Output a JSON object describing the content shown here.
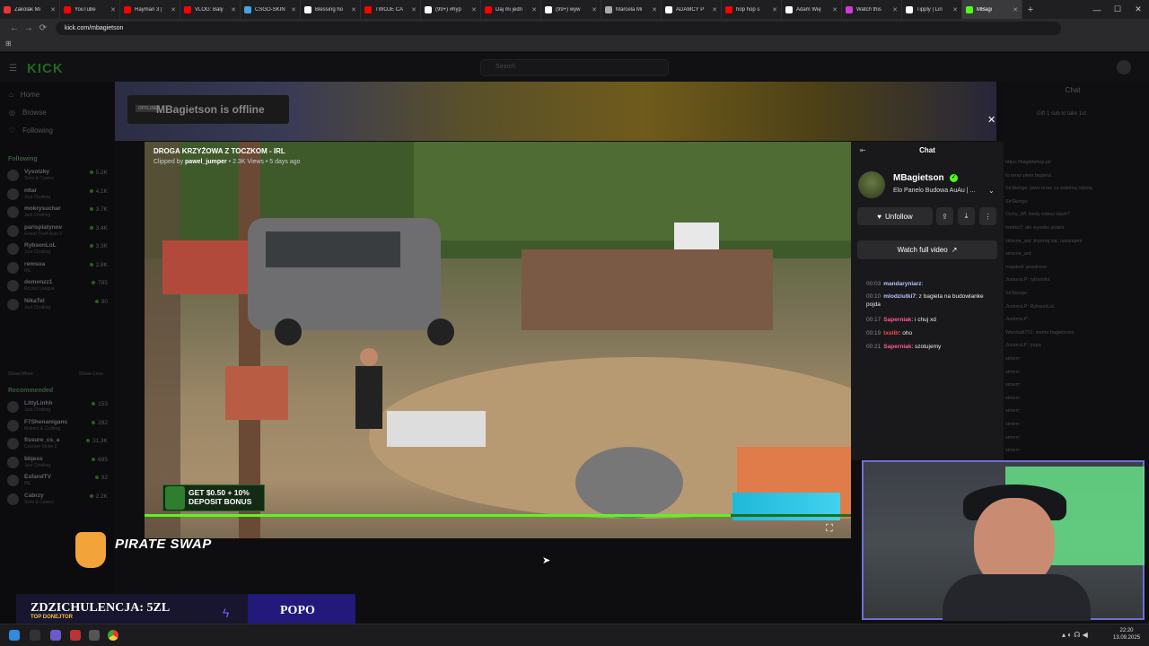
{
  "browser": {
    "tabs": [
      {
        "label": "Zakolak Mi",
        "color": "#e33"
      },
      {
        "label": "YouTube",
        "color": "#f00"
      },
      {
        "label": "Rayman 3 |",
        "color": "#f00"
      },
      {
        "label": "VLOG: Baly",
        "color": "#f00"
      },
      {
        "label": "CSGO-SKIN",
        "color": "#4aa3df"
      },
      {
        "label": "Blessing ho",
        "color": "#fff"
      },
      {
        "label": "TWOJE CA",
        "color": "#f00"
      },
      {
        "label": "(99+) #hyp",
        "color": "#fff"
      },
      {
        "label": "Daj mi jedn",
        "color": "#f00"
      },
      {
        "label": "(99+) wyw",
        "color": "#fff"
      },
      {
        "label": "Marcela Mi",
        "color": "#aaa"
      },
      {
        "label": "ADAMCY P",
        "color": "#fff"
      },
      {
        "label": "hop hop s",
        "color": "#f00"
      },
      {
        "label": "Adam Wię",
        "color": "#fff"
      },
      {
        "label": "Watch this",
        "color": "#d43ad8"
      },
      {
        "label": "Tipply | Lin",
        "color": "#fff"
      },
      {
        "label": "MBagi",
        "color": "#53fc18"
      }
    ],
    "url": "kick.com/mbagietson",
    "new_tab": "+",
    "controls": {
      "minimize": "—",
      "maximize": "☐",
      "close": "✕"
    }
  },
  "kick": {
    "logo": "KICK",
    "search_placeholder": "Search",
    "nav": [
      "Home",
      "Browse",
      "Following"
    ],
    "following_header": "Following",
    "recommended_header": "Recommended",
    "show_more": "Show More",
    "show_less": "Show Less",
    "following": [
      {
        "name": "Vysotzky",
        "cat": "Slots & Casino",
        "viewers": "5.2K"
      },
      {
        "name": "nitar",
        "cat": "Just Chatting",
        "viewers": "4.1K"
      },
      {
        "name": "mokrysuchar",
        "cat": "Just Chatting",
        "viewers": "3.7K"
      },
      {
        "name": "parisplatynov",
        "cat": "Grand Theft Auto V",
        "viewers": "3.4K"
      },
      {
        "name": "RybsonLoL",
        "cat": "Just Chatting",
        "viewers": "3.3K"
      },
      {
        "name": "remsua",
        "cat": "IRL",
        "viewers": "2.8K"
      },
      {
        "name": "demonzz1",
        "cat": "Rocket League",
        "viewers": "785"
      },
      {
        "name": "NikaTel",
        "cat": "Just Chatting",
        "viewers": "90"
      }
    ],
    "recommended": [
      {
        "name": "LittyLinhh",
        "cat": "Just Chatting",
        "viewers": "153"
      },
      {
        "name": "F7Shenanigans",
        "cat": "Makers & Crafting",
        "viewers": "292"
      },
      {
        "name": "fissure_cs_a",
        "cat": "Counter-Strike 2",
        "viewers": "31.3K"
      },
      {
        "name": "bbjess",
        "cat": "Just Chatting",
        "viewers": "695"
      },
      {
        "name": "EsfandTV",
        "cat": "IRL",
        "viewers": "92"
      },
      {
        "name": "Cabrzy",
        "cat": "Slots & Casino",
        "viewers": "2.2K"
      }
    ],
    "offline_tag": "OFFLINE",
    "offline_text": "MBagietson is offline",
    "right_chat": {
      "title": "Chat",
      "gift": "Gift 1 sub to take 1st",
      "lines": [
        "https://bagietshop.pl/",
        "to teraz piwo bagieta",
        "SirSkorge: piwo teraz za świetną robotę",
        "SirSkorge:",
        "Cichy_68: kiedy robisz dach?",
        "tomiks7: ale wysoko jesteś",
        "simone_ant: trzymaj się, nawzajem",
        "simone_ant:",
        "majakeli: pozdrooo",
        "JuniorsLP: rybsonlol",
        "SirSkorge:",
        "JuniorsLP: RybsonLoL",
        "JuniorsLP:",
        "Wiecha8701: siema bagietsonn",
        "JuniorsLP: papa",
        "simerr:",
        "simerr:",
        "simerr:",
        "simerr:",
        "simerr:",
        "simerr:",
        "simerr:",
        "simerr:",
        "simerr:"
      ]
    }
  },
  "clip": {
    "title": "DROGA KRZYŻOWA Z TOCZKOM - IRL",
    "clipped_by_label": "Clipped by",
    "clipper": "pawel_jumper",
    "views": "2.3K Views",
    "age": "5 days ago",
    "progress": 0.83,
    "bonus_ad": "GET $0.50 + 10% DEPOSIT BONUS",
    "close": "✕",
    "fullscreen": "⛶"
  },
  "chat_panel": {
    "collapse_icon": "⇤",
    "title": "Chat",
    "channel_name": "MBagietson",
    "verified": "✓",
    "description": "Elo Panelo Budowa AuAu | ...",
    "unfollow": "Unfollow",
    "watch_full": "Watch full video",
    "messages": [
      {
        "ts": "00:03",
        "user": "mandaryniarz",
        "color": "#b9c4ff",
        "text": ""
      },
      {
        "ts": "00:10",
        "user": "mlodziutki7",
        "color": "#b9c4ff",
        "text": "z bagieta na budowlanke pojda"
      },
      {
        "ts": "00:17",
        "user": "Saperniak",
        "color": "#ff5d8f",
        "text": "i chuj xd"
      },
      {
        "ts": "00:19",
        "user": "Ixstilr",
        "color": "#ff4b4b",
        "text": "oho"
      },
      {
        "ts": "00:21",
        "user": "Saperniak",
        "color": "#ff5d8f",
        "text": "szotujemy"
      }
    ]
  },
  "overlay": {
    "pirate_logo": "PIRATE SWAP",
    "donor_label": "ZDZICHULENCJA: 5ZL",
    "donor_sub": "TOP DONEJTOR",
    "donor_name": "POPO"
  },
  "taskbar": {
    "time": "22:20",
    "date": "13.09.2025"
  }
}
